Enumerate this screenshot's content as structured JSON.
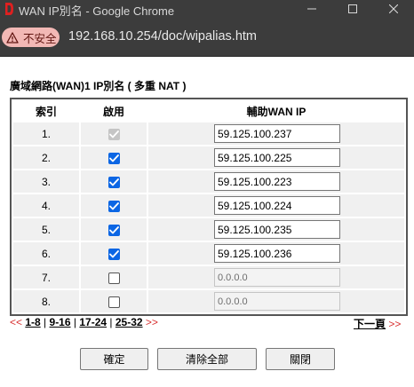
{
  "window": {
    "title": "WAN IP別名 - Google Chrome",
    "controls": [
      "minimize-icon",
      "maximize-icon",
      "close-icon"
    ]
  },
  "addressbar": {
    "security_label": "不安全",
    "security_icon": "warning-icon",
    "url": "192.168.10.254/doc/wipalias.htm"
  },
  "page": {
    "heading": "廣域網路(WAN)1  IP別名 ( 多重 NAT )",
    "columns": [
      "索引",
      "啟用",
      "輔助WAN IP"
    ],
    "rows": [
      {
        "index": "1.",
        "enabled": true,
        "disabled": true,
        "ip": "59.125.100.237",
        "ip_disabled": false
      },
      {
        "index": "2.",
        "enabled": true,
        "disabled": false,
        "ip": "59.125.100.225",
        "ip_disabled": false
      },
      {
        "index": "3.",
        "enabled": true,
        "disabled": false,
        "ip": "59.125.100.223",
        "ip_disabled": false
      },
      {
        "index": "4.",
        "enabled": true,
        "disabled": false,
        "ip": "59.125.100.224",
        "ip_disabled": false
      },
      {
        "index": "5.",
        "enabled": true,
        "disabled": false,
        "ip": "59.125.100.235",
        "ip_disabled": false
      },
      {
        "index": "6.",
        "enabled": true,
        "disabled": false,
        "ip": "59.125.100.236",
        "ip_disabled": false
      },
      {
        "index": "7.",
        "enabled": false,
        "disabled": false,
        "ip": "0.0.0.0",
        "ip_disabled": true
      },
      {
        "index": "8.",
        "enabled": false,
        "disabled": false,
        "ip": "0.0.0.0",
        "ip_disabled": true
      }
    ],
    "pager": {
      "prev_arrow": "<<",
      "next_arrow": ">>",
      "links": [
        "1-8",
        "9-16",
        "17-24",
        "25-32"
      ],
      "separator": "|",
      "next_page_label": "下一頁",
      "next_page_arrow": ">>"
    },
    "buttons": {
      "ok": "確定",
      "clear_all": "清除全部",
      "close": "關閉"
    }
  },
  "colors": {
    "titlebar_bg": "#3c3c3c",
    "security_chip_bg": "#f2b8b5",
    "checkbox_checked": "#0b66e4",
    "pager_arrow": "#d83030"
  }
}
